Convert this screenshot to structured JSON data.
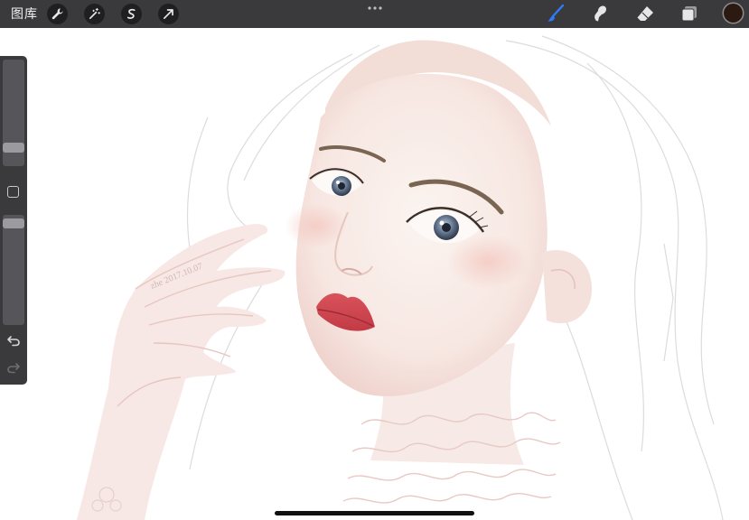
{
  "toolbar": {
    "gallery_label": "图库",
    "left_tools": [
      "wrench-icon",
      "magic-wand-icon",
      "selection-icon",
      "transform-arrow-icon"
    ],
    "right_tools": [
      "brush-icon",
      "smudge-icon",
      "eraser-icon",
      "layers-icon"
    ],
    "active_tool": "brush-icon",
    "active_color": "#2a1a12",
    "accent_color": "#2f7bf5"
  },
  "sidebar": {
    "brush_size_level": 0.17,
    "opacity_level": 1.0,
    "controls": [
      "brush-size-slider",
      "modify-button",
      "opacity-slider",
      "undo-icon",
      "redo-icon"
    ]
  },
  "canvas": {
    "subject": "watercolor portrait illustration",
    "signature_text": "zhe 2017.10.07"
  }
}
